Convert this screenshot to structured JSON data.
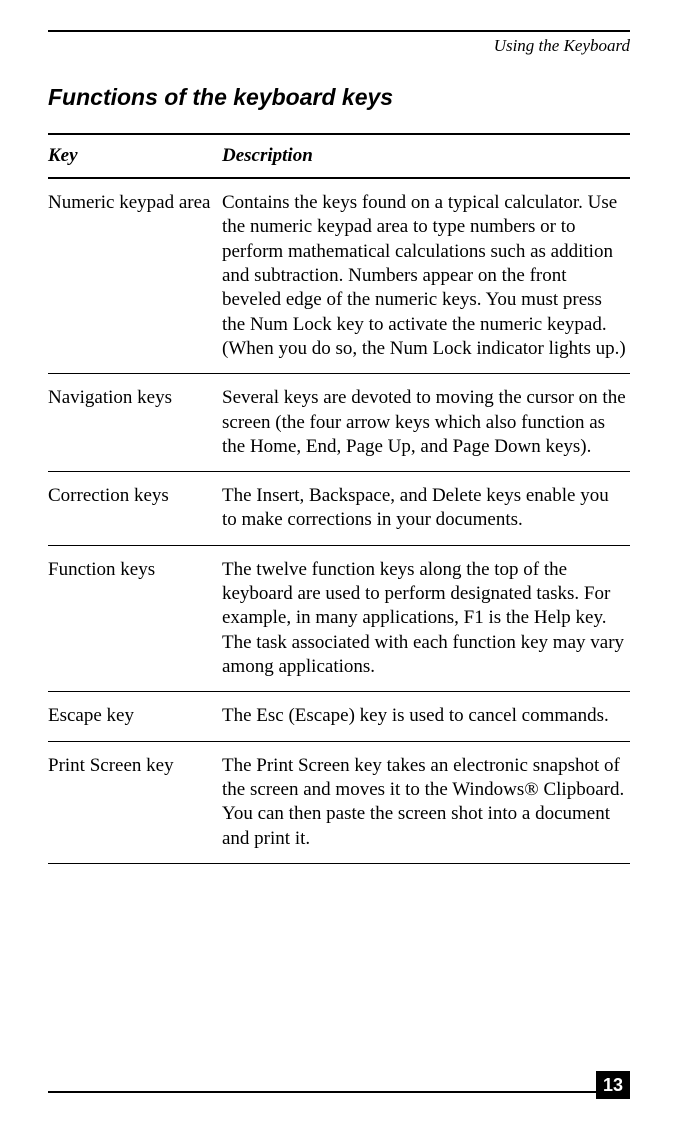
{
  "running_head": "Using the Keyboard",
  "section_title": "Functions of the keyboard keys",
  "table": {
    "head_key": "Key",
    "head_desc": "Description",
    "rows": [
      {
        "key": "Numeric keypad area",
        "desc": "Contains the keys found on a typical calculator. Use the numeric keypad area to type numbers or to perform mathematical calculations such as addition and subtraction. Numbers appear on the front beveled edge of the numeric keys. You must press the Num Lock key to activate the numeric keypad. (When you do so, the Num Lock indicator lights up.)"
      },
      {
        "key": "Navigation keys",
        "desc": "Several keys are devoted to moving the cursor on the screen (the four arrow keys which also function as the Home, End, Page Up, and Page Down keys)."
      },
      {
        "key": "Correction keys",
        "desc": "The Insert, Backspace, and Delete keys enable you to make corrections in your documents."
      },
      {
        "key": "Function keys",
        "desc": "The twelve function keys along the top of the keyboard are used to perform designated tasks. For example, in many applications, F1 is the Help key. The task associated with each function key may vary among applications."
      },
      {
        "key": "Escape key",
        "desc": "The Esc (Escape) key is used to cancel commands."
      },
      {
        "key": "Print Screen key",
        "desc": "The Print Screen key takes an electronic snapshot of the screen and moves it to the Windows® Clipboard. You can then paste the screen shot into a document and print it."
      }
    ]
  },
  "page_number": "13"
}
